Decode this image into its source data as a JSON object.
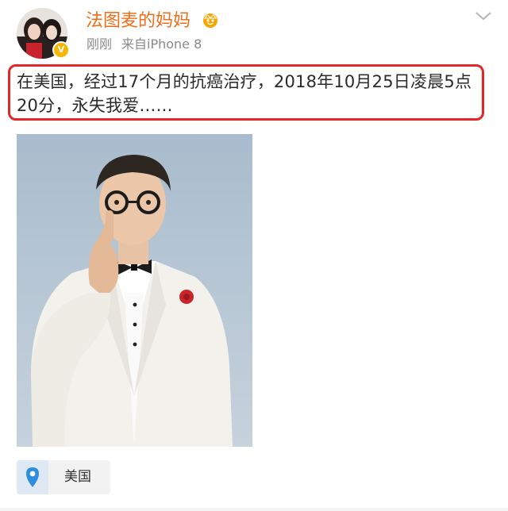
{
  "post": {
    "author": "法图麦的妈妈",
    "time": "刚刚",
    "source": "来自iPhone 8",
    "text": "在美国，经过17个月的抗癌治疗，2018年10月25日凌晨5点20分，永失我爱……",
    "location": "美国"
  },
  "colors": {
    "author_name": "#f26d19",
    "highlight_border": "#e52626",
    "meta_gray": "#8a8a8a",
    "location_pin": "#2d8de0"
  },
  "icons": {
    "more": "chevron-down-icon",
    "verified": "verified-badge-icon",
    "member": "crown-badge-icon",
    "location": "location-pin-icon"
  }
}
